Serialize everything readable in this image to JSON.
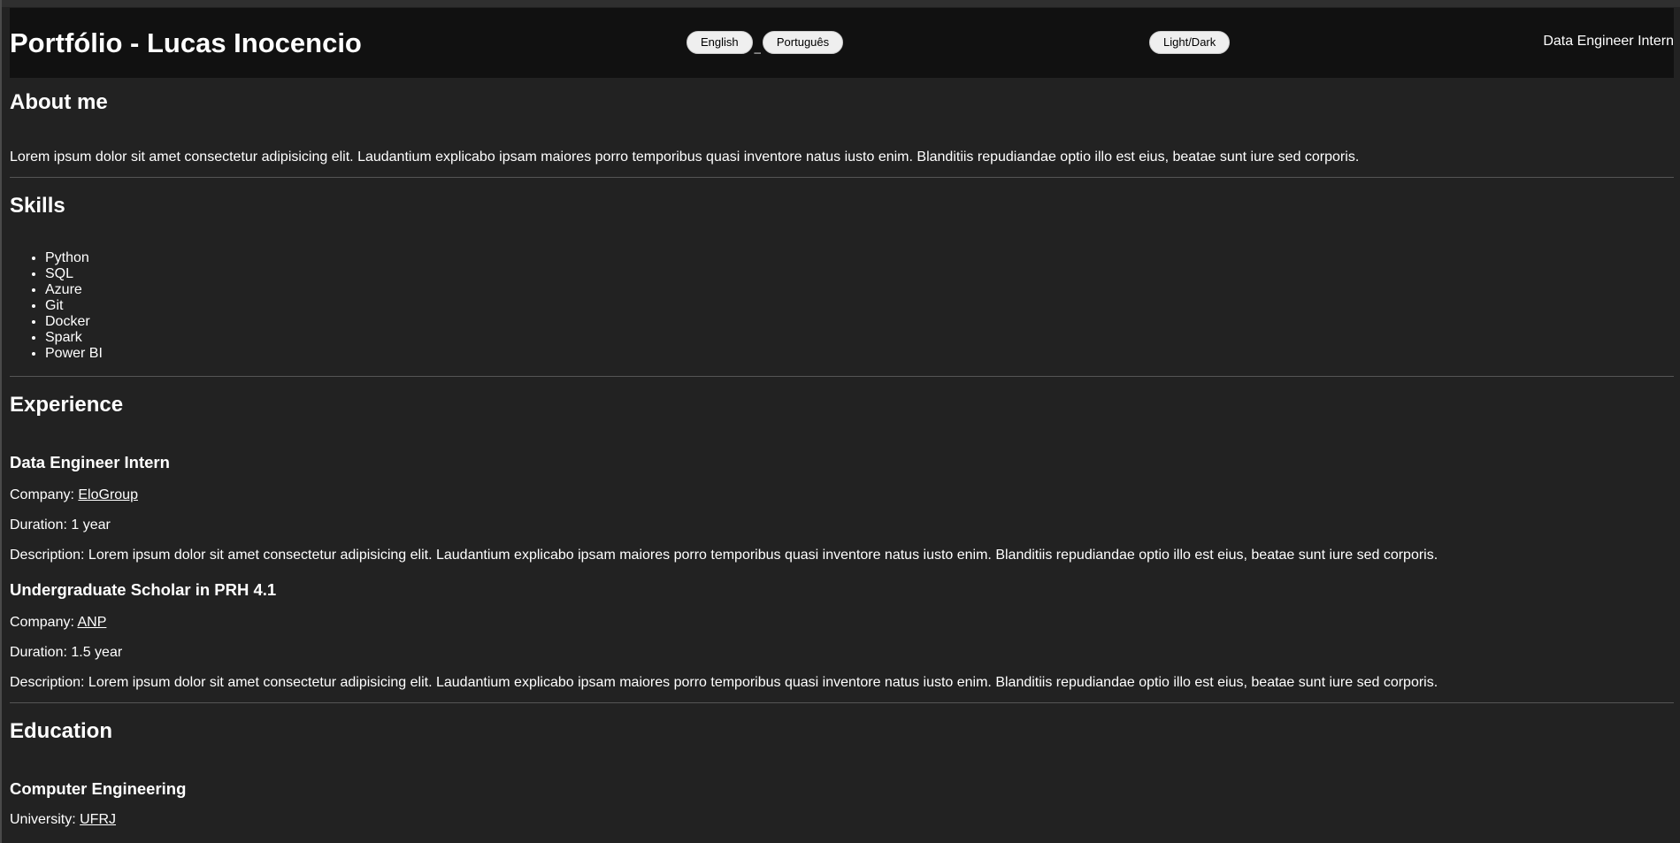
{
  "header": {
    "title": "Portfólio - Lucas Inocencio",
    "lang_buttons": [
      "English",
      "Português"
    ],
    "lang_separator": "_",
    "theme_button": "Light/Dark",
    "role": "Data Engineer Intern"
  },
  "about": {
    "heading": "About me",
    "text": "Lorem ipsum dolor sit amet consectetur adipisicing elit. Laudantium explicabo ipsam maiores porro temporibus quasi inventore natus iusto enim. Blanditiis repudiandae optio illo est eius, beatae sunt iure sed corporis."
  },
  "skills": {
    "heading": "Skills",
    "items": [
      "Python",
      "SQL",
      "Azure",
      "Git",
      "Docker",
      "Spark",
      "Power BI"
    ]
  },
  "experience": {
    "heading": "Experience",
    "jobs": [
      {
        "title": "Data Engineer Intern",
        "company_label": "Company: ",
        "company": "EloGroup",
        "duration": "Duration: 1 year",
        "description": "Description: Lorem ipsum dolor sit amet consectetur adipisicing elit. Laudantium explicabo ipsam maiores porro temporibus quasi inventore natus iusto enim. Blanditiis repudiandae optio illo est eius, beatae sunt iure sed corporis."
      },
      {
        "title": "Undergraduate Scholar in PRH 4.1",
        "company_label": "Company: ",
        "company": "ANP",
        "duration": "Duration: 1.5 year",
        "description": "Description: Lorem ipsum dolor sit amet consectetur adipisicing elit. Laudantium explicabo ipsam maiores porro temporibus quasi inventore natus iusto enim. Blanditiis repudiandae optio illo est eius, beatae sunt iure sed corporis."
      }
    ]
  },
  "education": {
    "heading": "Education",
    "degree": "Computer Engineering",
    "university_label": "University: ",
    "university": "UFRJ"
  }
}
